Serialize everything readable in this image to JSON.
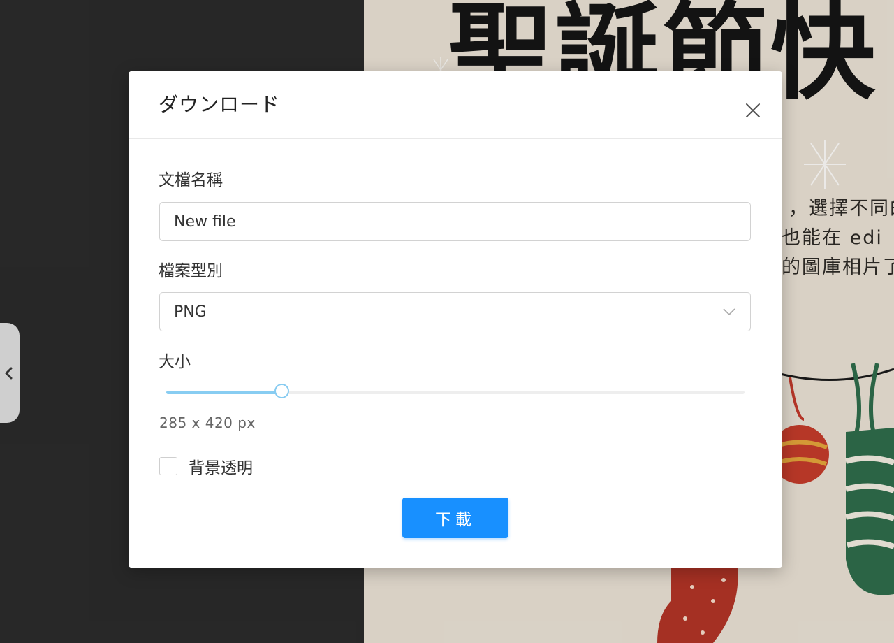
{
  "background": {
    "poster_title": "聖誕節快",
    "poster_lines": [
      "，選擇不同的",
      "也能在 edi",
      "的圖庫相片了"
    ]
  },
  "side_tab": {
    "icon": "chevron-left-icon"
  },
  "dialog": {
    "title": "ダウンロード",
    "close_icon": "close-icon",
    "filename": {
      "label": "文檔名稱",
      "value": "New file"
    },
    "filetype": {
      "label": "檔案型別",
      "value": "PNG",
      "icon": "chevron-down-icon"
    },
    "size": {
      "label": "大小",
      "slider_value_fraction": 0.2,
      "readout": "285 x 420 px"
    },
    "transparent_bg": {
      "label": "背景透明",
      "checked": false
    },
    "download_button": "下載"
  },
  "colors": {
    "accent": "#1890ff",
    "slider": "#88cdf2",
    "backdrop": "#2a2a2a",
    "poster": "#e7dfd2"
  }
}
